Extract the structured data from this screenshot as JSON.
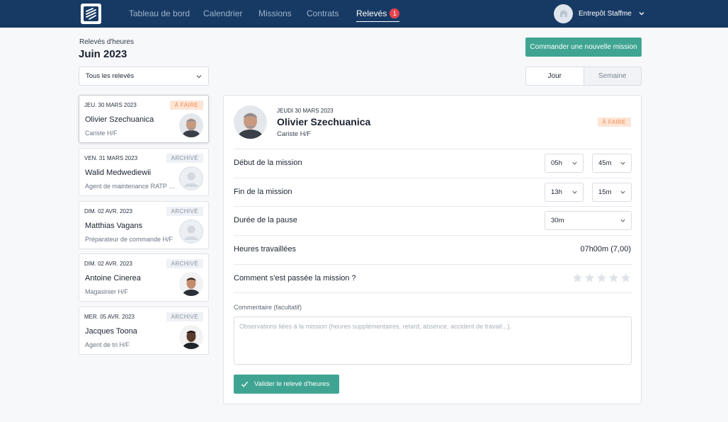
{
  "nav": {
    "items": [
      "Tableau de bord",
      "Calendrier",
      "Missions",
      "Contrats",
      "Relevés"
    ],
    "active_badge": "1",
    "account_name": "Entrepôt Staffme"
  },
  "header": {
    "breadcrumb": "Relevés d'heures",
    "title": "Juin 2023",
    "order_button": "Commander une nouvelle mission"
  },
  "filter": {
    "selected": "Tous les relevés"
  },
  "view_toggle": {
    "day": "Jour",
    "week": "Semaine",
    "active": "Jour"
  },
  "list": [
    {
      "date": "JEU. 30 MARS 2023",
      "status": "À FAIRE",
      "name": "Olivier Szechuanica",
      "job": "Cariste H/F",
      "avatar": "photo-older-man"
    },
    {
      "date": "VEN. 31 MARS 2023",
      "status": "ARCHIVÉ",
      "name": "Walid Medwediewii",
      "job": "Agent de maintenance RATP H/F",
      "avatar": "placeholder"
    },
    {
      "date": "DIM. 02 AVR. 2023",
      "status": "ARCHIVÉ",
      "name": "Matthias Vagans",
      "job": "Préparateur de commande H/F",
      "avatar": "placeholder"
    },
    {
      "date": "DIM. 02 AVR. 2023",
      "status": "ARCHIVÉ",
      "name": "Antoine Cinerea",
      "job": "Magasinier H/F",
      "avatar": "photo-young-man"
    },
    {
      "date": "MER. 05 AVR. 2023",
      "status": "ARCHIVÉ",
      "name": "Jacques Toona",
      "job": "Agent de tri H/F",
      "avatar": "photo-man-dark"
    }
  ],
  "detail": {
    "date": "JEUDI 30 MARS 2023",
    "name": "Olivier Szechuanica",
    "job": "Cariste H/F",
    "status": "À FAIRE",
    "start_label": "Début de la mission",
    "start_hour": "05h",
    "start_min": "45m",
    "end_label": "Fin de la mission",
    "end_hour": "13h",
    "end_min": "15m",
    "break_label": "Durée de la pause",
    "break_value": "30m",
    "worked_label": "Heures travaillées",
    "worked_value": "07h00m (7,00)",
    "rating_label": "Comment s'est passée la mission ?",
    "rating": 0,
    "rating_max": 5,
    "comment_label": "Commentaire (facultatif)",
    "comment_placeholder": "Observations liées à la mission (heures supplémentaires, retard, absence, accident de travail...).",
    "validate_button": "Valider le relevé d'heures"
  },
  "colors": {
    "nav_bg": "#173a64",
    "accent": "#3fa592",
    "todo_tag_bg": "#fde5d6",
    "todo_tag_text": "#f08a4b",
    "badge": "#e8434d"
  }
}
